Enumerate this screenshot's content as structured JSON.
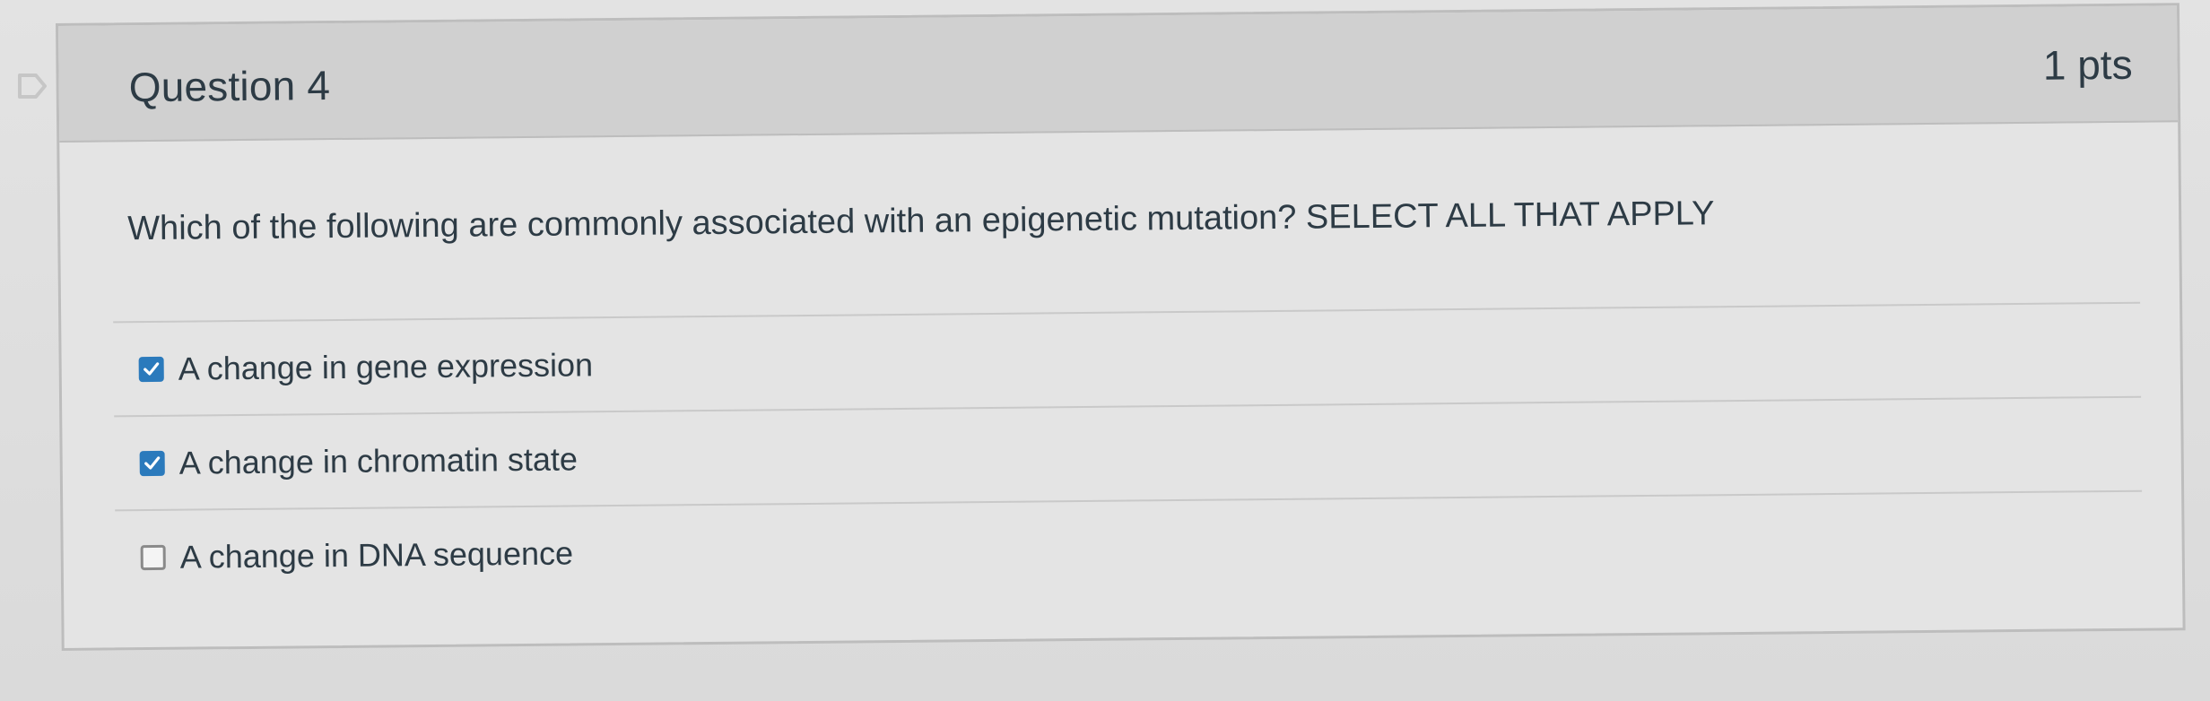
{
  "question": {
    "title": "Question 4",
    "points": "1 pts",
    "text": "Which of the following are commonly associated with an epigenetic mutation? SELECT ALL THAT APPLY"
  },
  "answers": [
    {
      "label": "A change in gene expression",
      "checked": true
    },
    {
      "label": "A change in chromatin state",
      "checked": true
    },
    {
      "label": "A change in DNA sequence",
      "checked": false
    }
  ],
  "colors": {
    "checkbox_checked": "#2b7abc",
    "text": "#2d3b45",
    "header_bg": "#d0d0d0"
  },
  "icons": {
    "flag": "flag-outline-icon",
    "checkmark": "checkmark-icon"
  }
}
